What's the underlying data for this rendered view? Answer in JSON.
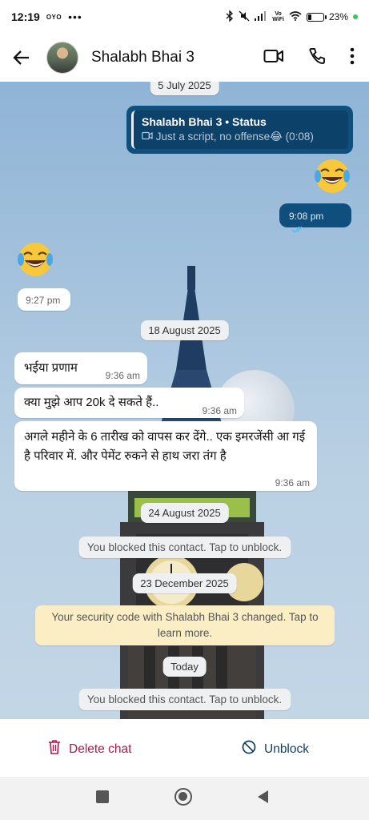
{
  "status_bar": {
    "time": "12:19",
    "carrier_badge": "OYO",
    "dots": "•••",
    "vowifi": "Vo\nWiFi",
    "battery": "23%",
    "battery_level": 0.23
  },
  "header": {
    "contact_name": "Shalabh Bhai 3"
  },
  "messages": {
    "date_july": "5 July 2025",
    "reply_title": "Shalabh Bhai 3 • Status",
    "reply_sub": "Just a script, no offense😂 (0:08)",
    "out_time": "9:08 pm",
    "in_emoji_time": "9:27 pm",
    "date_aug18": "18 August 2025",
    "msg1": "भईया प्रणाम",
    "msg1_time": "9:36 am",
    "msg2": "क्या मुझे आप 20k दे सकते हैं..",
    "msg2_time": "9:36 am",
    "msg3": "अगले महीने के 6 तारीख को वापस कर देंगे.. एक इमरजेंसी आ गई है परिवार में. और पेमेंट रुकने से हाथ जरा तंग है",
    "msg3_time": "9:36 am",
    "date_aug24": "24 August 2025",
    "blocked1": "You blocked this contact. Tap to unblock.",
    "date_dec23": "23 December 2025",
    "security": "Your security code with Shalabh Bhai 3 changed. Tap to learn more.",
    "date_today": "Today",
    "blocked2": "You blocked this contact. Tap to unblock."
  },
  "footer": {
    "delete_label": "Delete chat",
    "unblock_label": "Unblock"
  },
  "colors": {
    "accent_red": "#b0174a",
    "accent_blue": "#0f4f7d",
    "outgoing_bubble": "#0f4f7d",
    "system_yellow": "#fbeec4"
  },
  "icons": [
    "back-arrow-icon",
    "video-call-icon",
    "phone-icon",
    "more-options-icon",
    "trash-icon",
    "block-icon",
    "recent-apps-icon",
    "home-icon",
    "back-nav-icon",
    "double-check-icon",
    "laughing-emoji-icon"
  ]
}
